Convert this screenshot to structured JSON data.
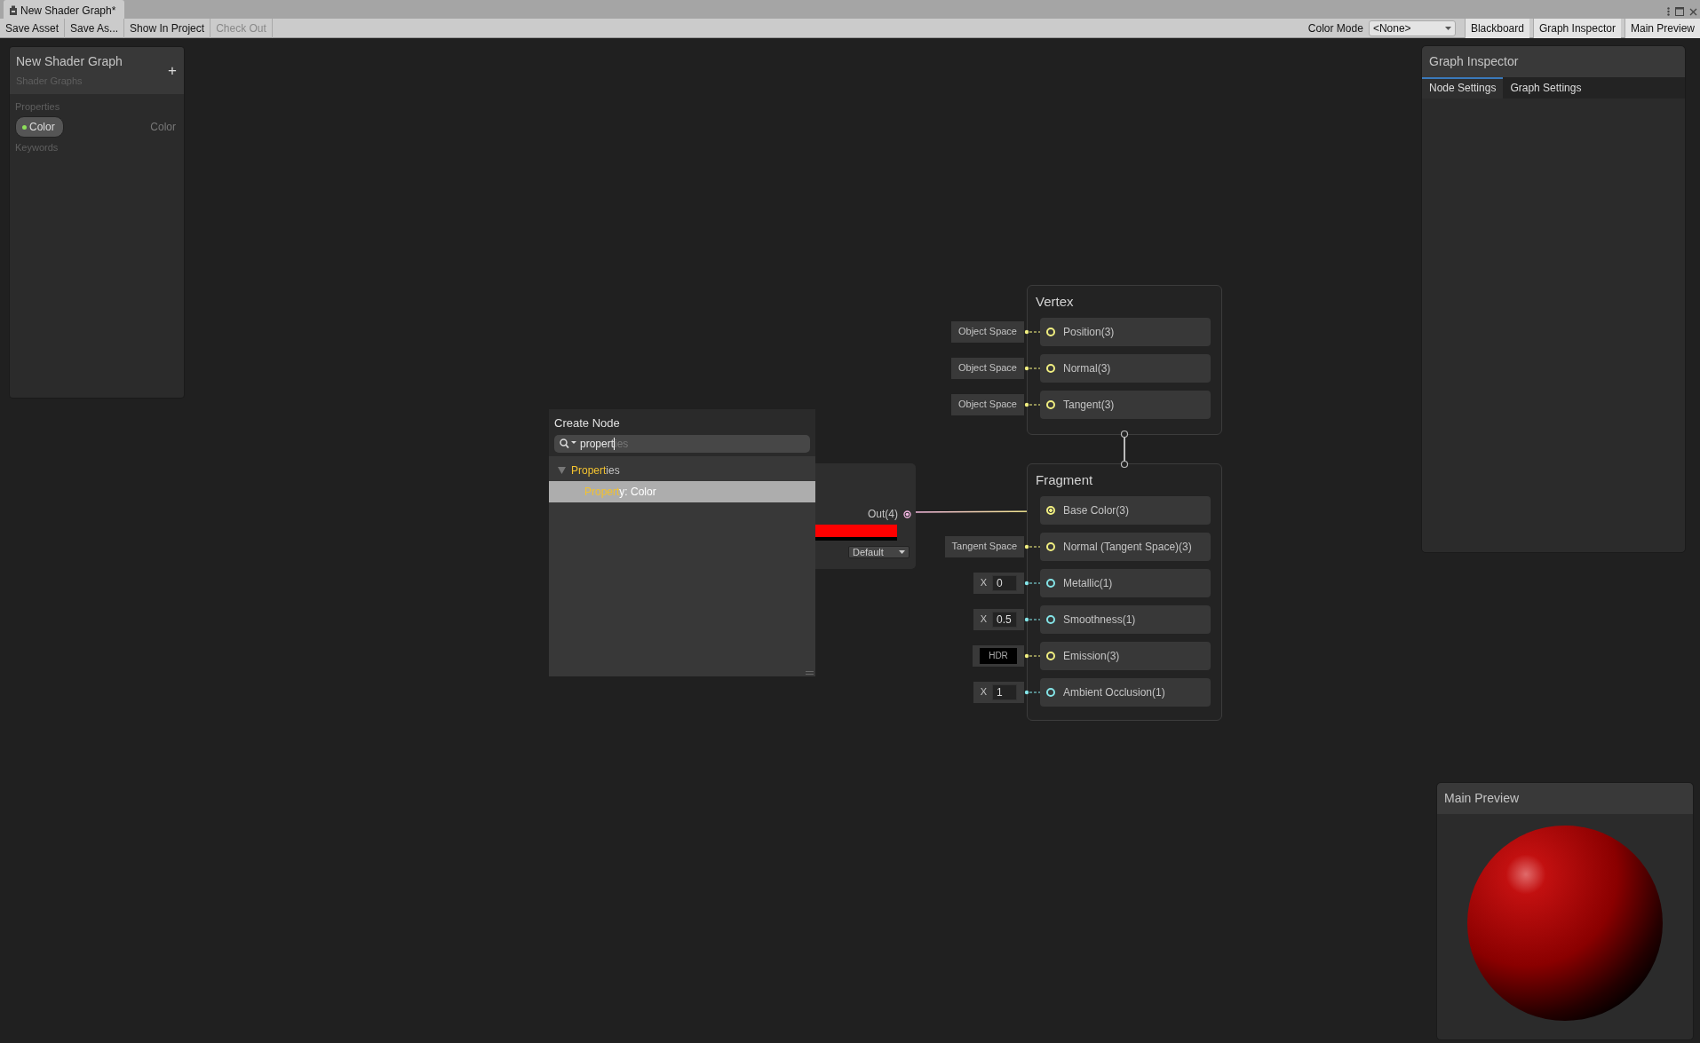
{
  "window": {
    "tab_title": "New Shader Graph*"
  },
  "toolbar": {
    "left_buttons": [
      {
        "label": "Save Asset",
        "disabled": false
      },
      {
        "label": "Save As...",
        "disabled": false
      },
      {
        "label": "Show In Project",
        "disabled": false
      },
      {
        "label": "Check Out",
        "disabled": true
      }
    ],
    "color_mode": {
      "label": "Color Mode",
      "value": "<None>"
    },
    "right_buttons": [
      {
        "label": "Blackboard"
      },
      {
        "label": "Graph Inspector"
      },
      {
        "label": "Main Preview"
      }
    ]
  },
  "blackboard": {
    "title": "New Shader Graph",
    "subtitle": "Shader Graphs",
    "add_button": "+",
    "sections": [
      {
        "title": "Properties",
        "items": [
          {
            "name": "Color",
            "type": "Color",
            "color": "#8ee05a"
          }
        ]
      },
      {
        "title": "Keywords"
      }
    ]
  },
  "create_node": {
    "title": "Create Node",
    "search": {
      "value": "propert",
      "completion": "ies"
    },
    "results": [
      {
        "match": "Propert",
        "rest": "ies",
        "expanded": true,
        "selected": false,
        "children": [
          {
            "match": "Propert",
            "rest": "y: Color",
            "selected": true
          }
        ]
      }
    ]
  },
  "property_node": {
    "output": "Out(4)",
    "color": "#ff0000",
    "mode": "Default"
  },
  "master_stack": {
    "vertex": {
      "title": "Vertex",
      "ports": [
        {
          "label": "Position(3)",
          "color": "#f0ee80",
          "input": {
            "kind": "space",
            "text": "Object Space"
          }
        },
        {
          "label": "Normal(3)",
          "color": "#f0ee80",
          "input": {
            "kind": "space",
            "text": "Object Space"
          }
        },
        {
          "label": "Tangent(3)",
          "color": "#f0ee80",
          "input": {
            "kind": "space",
            "text": "Object Space"
          }
        }
      ]
    },
    "fragment": {
      "title": "Fragment",
      "ports": [
        {
          "label": "Base Color(3)",
          "color": "#f0ee80",
          "connected": true
        },
        {
          "label": "Normal (Tangent Space)(3)",
          "color": "#f0ee80",
          "connected": false,
          "input": {
            "kind": "space",
            "text": "Tangent Space"
          }
        },
        {
          "label": "Metallic(1)",
          "color": "#84e4e7",
          "connected": false,
          "input": {
            "kind": "float",
            "axis": "X",
            "value": "0"
          }
        },
        {
          "label": "Smoothness(1)",
          "color": "#84e4e7",
          "connected": false,
          "input": {
            "kind": "float",
            "axis": "X",
            "value": "0.5"
          }
        },
        {
          "label": "Emission(3)",
          "color": "#f0ee80",
          "connected": false,
          "input": {
            "kind": "hdr",
            "text": "HDR"
          }
        },
        {
          "label": "Ambient Occlusion(1)",
          "color": "#84e4e7",
          "connected": false,
          "input": {
            "kind": "float",
            "axis": "X",
            "value": "1"
          }
        }
      ]
    }
  },
  "graph_inspector": {
    "title": "Graph Inspector",
    "tabs": [
      {
        "label": "Node Settings",
        "selected": true
      },
      {
        "label": "Graph Settings",
        "selected": false
      }
    ]
  },
  "main_preview": {
    "title": "Main Preview"
  }
}
